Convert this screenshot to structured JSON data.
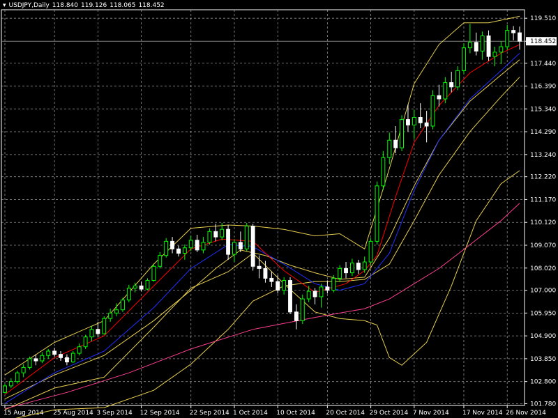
{
  "header": {
    "symbol": "USDJPY,Daily",
    "open": "118.840",
    "high": "119.126",
    "low": "118.065",
    "close": "118.452"
  },
  "colors": {
    "background": "#000000",
    "grid": "#c0c0c0",
    "axis": "#ffffff",
    "bull": "#00ff00",
    "bear": "#ffffff",
    "ma_fast": "#ff0000",
    "ma_mid": "#2030ff",
    "ma_slow": "#ff4090",
    "bands": "#e8d050",
    "price_line": "#808080"
  },
  "chart_data": {
    "type": "candlestick",
    "y_tick_labels": [
      "119.510",
      "118.452",
      "117.440",
      "116.390",
      "115.340",
      "114.290",
      "113.240",
      "112.220",
      "111.170",
      "110.120",
      "109.070",
      "108.020",
      "107.000",
      "105.950",
      "104.900",
      "103.850",
      "102.800",
      "101.780"
    ],
    "ylim": [
      101.7,
      119.9
    ],
    "current_price": 118.452,
    "x_tick_labels": [
      "15 Aug 2014",
      "25 Aug 2014",
      "3 Sep 2014",
      "12 Sep 2014",
      "22 Sep 2014",
      "1 Oct 2014",
      "10 Oct 2014",
      "20 Oct 2014",
      "29 Oct 2014",
      "7 Nov 2014",
      "17 Nov 2014",
      "26 Nov 2014"
    ],
    "x_tick_index": [
      0,
      8,
      15,
      22,
      30,
      37,
      44,
      52,
      59,
      66,
      74,
      81
    ],
    "grid": true,
    "candles": [
      [
        102.3,
        102.7,
        102.25,
        102.6
      ],
      [
        102.6,
        102.95,
        102.5,
        102.8
      ],
      [
        102.8,
        103.3,
        102.7,
        103.2
      ],
      [
        103.2,
        103.6,
        103.0,
        103.45
      ],
      [
        103.45,
        103.95,
        103.35,
        103.85
      ],
      [
        103.85,
        104.05,
        103.55,
        103.75
      ],
      [
        103.75,
        104.15,
        103.65,
        104.0
      ],
      [
        104.0,
        104.3,
        103.85,
        104.2
      ],
      [
        104.2,
        104.35,
        103.95,
        104.05
      ],
      [
        104.05,
        104.2,
        103.75,
        103.9
      ],
      [
        103.9,
        104.05,
        103.55,
        103.7
      ],
      [
        103.7,
        104.2,
        103.65,
        104.1
      ],
      [
        104.1,
        104.55,
        104.0,
        104.4
      ],
      [
        104.4,
        104.95,
        104.3,
        104.85
      ],
      [
        104.85,
        105.35,
        104.65,
        105.2
      ],
      [
        105.2,
        105.55,
        104.85,
        105.0
      ],
      [
        105.0,
        105.8,
        104.95,
        105.7
      ],
      [
        105.7,
        106.15,
        105.55,
        105.95
      ],
      [
        105.95,
        106.4,
        105.8,
        106.1
      ],
      [
        106.1,
        106.65,
        106.0,
        106.55
      ],
      [
        106.55,
        107.25,
        106.45,
        107.1
      ],
      [
        107.1,
        107.35,
        106.9,
        107.2
      ],
      [
        107.2,
        107.4,
        106.95,
        107.05
      ],
      [
        107.05,
        107.55,
        107.0,
        107.45
      ],
      [
        107.45,
        108.2,
        107.4,
        108.1
      ],
      [
        108.1,
        108.75,
        108.0,
        108.6
      ],
      [
        108.6,
        109.4,
        108.5,
        109.25
      ],
      [
        109.25,
        109.45,
        108.7,
        108.9
      ],
      [
        108.9,
        109.05,
        108.55,
        108.7
      ],
      [
        108.7,
        109.1,
        108.4,
        108.95
      ],
      [
        108.95,
        109.5,
        108.8,
        109.3
      ],
      [
        109.3,
        109.55,
        108.75,
        108.85
      ],
      [
        108.85,
        109.45,
        108.7,
        109.2
      ],
      [
        109.2,
        109.85,
        109.1,
        109.7
      ],
      [
        109.7,
        110.05,
        109.25,
        109.45
      ],
      [
        109.45,
        110.1,
        109.3,
        109.8
      ],
      [
        109.8,
        110.0,
        108.4,
        108.65
      ],
      [
        108.65,
        109.35,
        108.3,
        109.2
      ],
      [
        109.2,
        109.7,
        108.75,
        108.9
      ],
      [
        108.9,
        110.1,
        108.8,
        109.95
      ],
      [
        109.95,
        110.05,
        107.9,
        108.1
      ],
      [
        108.1,
        108.6,
        107.55,
        108.0
      ],
      [
        108.0,
        108.35,
        107.35,
        107.55
      ],
      [
        107.55,
        107.85,
        107.15,
        107.4
      ],
      [
        107.4,
        107.7,
        106.85,
        107.0
      ],
      [
        107.0,
        107.6,
        106.8,
        107.45
      ],
      [
        107.45,
        107.6,
        105.9,
        106.0
      ],
      [
        106.0,
        106.35,
        105.2,
        105.6
      ],
      [
        105.6,
        106.8,
        105.45,
        106.6
      ],
      [
        106.6,
        107.2,
        106.45,
        106.95
      ],
      [
        106.95,
        107.1,
        106.35,
        106.7
      ],
      [
        106.7,
        107.3,
        106.2,
        107.15
      ],
      [
        107.15,
        107.45,
        106.85,
        107.0
      ],
      [
        107.0,
        107.7,
        106.9,
        107.55
      ],
      [
        107.55,
        108.15,
        107.4,
        108.0
      ],
      [
        108.0,
        108.3,
        107.55,
        107.8
      ],
      [
        107.8,
        108.45,
        107.65,
        108.25
      ],
      [
        108.25,
        108.4,
        107.75,
        107.95
      ],
      [
        107.95,
        108.55,
        107.8,
        108.3
      ],
      [
        108.3,
        109.4,
        108.15,
        109.25
      ],
      [
        109.25,
        112.0,
        109.1,
        111.8
      ],
      [
        111.8,
        113.4,
        111.6,
        113.1
      ],
      [
        113.1,
        114.25,
        112.8,
        113.9
      ],
      [
        113.9,
        114.55,
        113.3,
        113.55
      ],
      [
        113.55,
        115.05,
        113.4,
        114.85
      ],
      [
        114.85,
        115.55,
        114.3,
        114.6
      ],
      [
        114.6,
        115.3,
        113.95,
        114.95
      ],
      [
        114.95,
        115.6,
        114.45,
        114.7
      ],
      [
        114.7,
        115.25,
        113.8,
        114.55
      ],
      [
        114.55,
        116.2,
        114.4,
        115.95
      ],
      [
        115.95,
        116.45,
        115.45,
        115.8
      ],
      [
        115.8,
        116.8,
        115.6,
        116.55
      ],
      [
        116.55,
        117.05,
        116.1,
        116.35
      ],
      [
        116.35,
        117.3,
        116.2,
        117.1
      ],
      [
        117.1,
        118.35,
        116.95,
        118.15
      ],
      [
        118.15,
        119.25,
        117.9,
        118.4
      ],
      [
        118.4,
        118.85,
        117.8,
        118.0
      ],
      [
        118.0,
        118.9,
        117.6,
        118.7
      ],
      [
        118.7,
        118.95,
        117.55,
        117.75
      ],
      [
        117.75,
        118.2,
        117.3,
        117.95
      ],
      [
        117.95,
        118.45,
        117.4,
        118.2
      ],
      [
        118.2,
        119.2,
        118.05,
        118.95
      ],
      [
        118.95,
        119.15,
        118.5,
        118.84
      ],
      [
        118.84,
        119.126,
        118.065,
        118.452
      ]
    ],
    "ma_fast": [
      [
        0,
        102.2
      ],
      [
        8,
        103.9
      ],
      [
        16,
        104.9
      ],
      [
        24,
        107.2
      ],
      [
        30,
        108.9
      ],
      [
        35,
        109.35
      ],
      [
        40,
        109.25
      ],
      [
        45,
        107.9
      ],
      [
        50,
        106.9
      ],
      [
        55,
        107.3
      ],
      [
        58,
        107.9
      ],
      [
        60,
        108.6
      ],
      [
        63,
        111.3
      ],
      [
        66,
        113.8
      ],
      [
        70,
        115.5
      ],
      [
        75,
        117.0
      ],
      [
        80,
        117.9
      ],
      [
        83,
        118.3
      ]
    ],
    "ma_mid": [
      [
        0,
        101.8
      ],
      [
        8,
        103.2
      ],
      [
        16,
        104.2
      ],
      [
        24,
        106.2
      ],
      [
        30,
        108.0
      ],
      [
        36,
        109.1
      ],
      [
        40,
        109.0
      ],
      [
        45,
        108.2
      ],
      [
        50,
        107.3
      ],
      [
        54,
        107.0
      ],
      [
        58,
        107.3
      ],
      [
        62,
        108.7
      ],
      [
        66,
        111.6
      ],
      [
        70,
        113.9
      ],
      [
        75,
        115.8
      ],
      [
        80,
        117.1
      ],
      [
        83,
        117.9
      ]
    ],
    "ma_slow": [
      [
        0,
        101.55
      ],
      [
        10,
        102.3
      ],
      [
        20,
        103.2
      ],
      [
        30,
        104.3
      ],
      [
        40,
        105.2
      ],
      [
        50,
        105.75
      ],
      [
        58,
        106.15
      ],
      [
        62,
        106.6
      ],
      [
        66,
        107.3
      ],
      [
        70,
        108.0
      ],
      [
        75,
        109.1
      ],
      [
        80,
        110.2
      ],
      [
        83,
        111.0
      ]
    ],
    "band_upper": [
      [
        0,
        103.1
      ],
      [
        8,
        104.6
      ],
      [
        16,
        105.6
      ],
      [
        24,
        108.2
      ],
      [
        30,
        109.85
      ],
      [
        36,
        110.0
      ],
      [
        40,
        109.95
      ],
      [
        45,
        109.8
      ],
      [
        50,
        109.5
      ],
      [
        54,
        109.6
      ],
      [
        58,
        108.9
      ],
      [
        62,
        112.6
      ],
      [
        66,
        116.5
      ],
      [
        70,
        118.3
      ],
      [
        74,
        119.3
      ],
      [
        78,
        119.3
      ],
      [
        83,
        119.6
      ]
    ],
    "band_lower": [
      [
        0,
        101.5
      ],
      [
        8,
        102.5
      ],
      [
        16,
        103.0
      ],
      [
        24,
        105.3
      ],
      [
        30,
        107.1
      ],
      [
        36,
        107.85
      ],
      [
        40,
        108.7
      ],
      [
        45,
        107.3
      ],
      [
        50,
        106.0
      ],
      [
        54,
        105.7
      ],
      [
        58,
        105.6
      ],
      [
        60,
        105.4
      ],
      [
        62,
        103.9
      ],
      [
        64,
        103.55
      ],
      [
        68,
        104.6
      ],
      [
        72,
        107.2
      ],
      [
        76,
        110.2
      ],
      [
        80,
        111.9
      ],
      [
        83,
        112.5
      ]
    ],
    "band_upper_b": [
      [
        0,
        102.0
      ],
      [
        8,
        103.1
      ],
      [
        16,
        104.0
      ],
      [
        24,
        105.6
      ],
      [
        30,
        107.0
      ],
      [
        34,
        108.0
      ],
      [
        38,
        108.85
      ],
      [
        42,
        108.6
      ],
      [
        46,
        108.15
      ],
      [
        50,
        107.8
      ],
      [
        54,
        107.5
      ],
      [
        58,
        107.6
      ],
      [
        62,
        109.4
      ],
      [
        66,
        111.8
      ],
      [
        70,
        113.9
      ],
      [
        75,
        115.7
      ],
      [
        80,
        116.9
      ],
      [
        83,
        117.6
      ]
    ],
    "band_lower_b": [
      [
        0,
        101.0
      ],
      [
        8,
        101.5
      ],
      [
        16,
        101.6
      ],
      [
        24,
        102.4
      ],
      [
        30,
        103.6
      ],
      [
        36,
        105.2
      ],
      [
        40,
        106.5
      ],
      [
        45,
        107.2
      ],
      [
        50,
        107.4
      ],
      [
        54,
        107.4
      ],
      [
        58,
        107.5
      ],
      [
        62,
        108.2
      ],
      [
        66,
        110.2
      ],
      [
        70,
        112.3
      ],
      [
        75,
        114.3
      ],
      [
        80,
        115.9
      ],
      [
        83,
        116.8
      ]
    ]
  }
}
